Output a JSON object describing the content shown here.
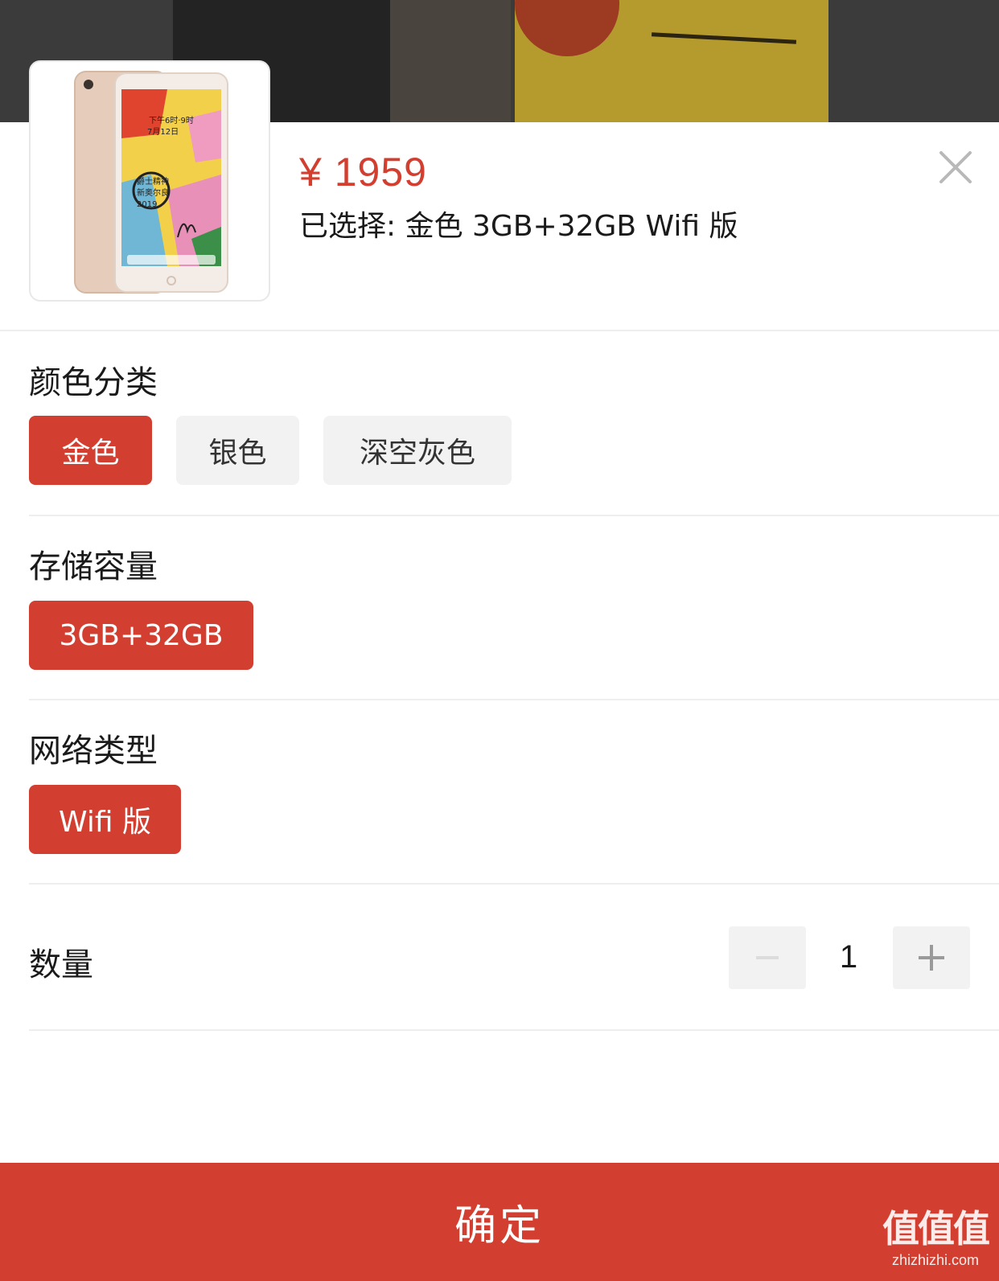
{
  "product": {
    "price": "¥ 1959",
    "selected_text": "已选择: 金色 3GB+32GB Wifi 版",
    "image_screen_text": "下午6时 · 9时 7月12日 爵士精神 新奥尔良 2019"
  },
  "sections": {
    "color": {
      "title": "颜色分类",
      "options": [
        {
          "label": "金色",
          "selected": true
        },
        {
          "label": "银色",
          "selected": false
        },
        {
          "label": "深空灰色",
          "selected": false
        }
      ]
    },
    "storage": {
      "title": "存储容量",
      "options": [
        {
          "label": "3GB+32GB",
          "selected": true
        }
      ]
    },
    "network": {
      "title": "网络类型",
      "options": [
        {
          "label": "Wifi 版",
          "selected": true
        }
      ]
    },
    "quantity": {
      "title": "数量",
      "value": "1",
      "minus_enabled": false
    }
  },
  "confirm_label": "确定",
  "watermark": {
    "main": "值值值",
    "sub": "zhizhizhi.com"
  },
  "colors": {
    "accent": "#d23f31",
    "option_inactive_bg": "#f2f2f2",
    "divider": "#eeeeee",
    "ipad_gold": "#e6cdbb"
  }
}
